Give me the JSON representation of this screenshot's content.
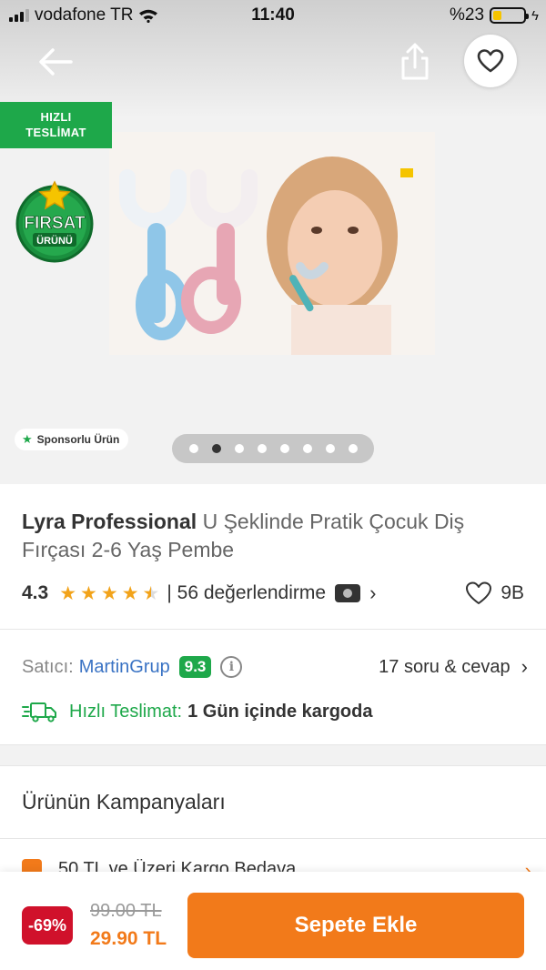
{
  "status_bar": {
    "carrier": "vodafone TR",
    "time": "11:40",
    "battery": "%23",
    "battery_level": 0.23
  },
  "header": {
    "back_icon": "arrow-left-icon",
    "share_icon": "share-icon",
    "favorite_icon": "heart-outline-icon"
  },
  "gallery": {
    "fast_badge_line1": "HIZLI",
    "fast_badge_line2": "TESLİMAT",
    "deal_badge_line1": "FIRSAT",
    "deal_badge_line2": "ÜRÜNÜ",
    "sponsored_label": "Sponsorlu Ürün",
    "slide_count": 8,
    "active_slide": 2
  },
  "product": {
    "brand": "Lyra Professional",
    "name": "U Şeklinde Pratik Çocuk Diş Fırçası 2-6 Yaş Pembe",
    "rating": "4.3",
    "rating_value": 4.3,
    "reviews": "| 56 değerlendirme",
    "likes": "9B"
  },
  "seller": {
    "label": "Satıcı:",
    "name": "MartinGrup",
    "score": "9.3",
    "qa": "17 soru & cevap"
  },
  "delivery": {
    "label": "Hızlı Teslimat:",
    "text": "1 Gün içinde kargoda"
  },
  "campaigns": {
    "title": "Ürünün Kampanyaları",
    "first_item": "50 TL ve Üzeri Kargo Bedava"
  },
  "bottom_bar": {
    "discount": "-69%",
    "old_price": "99.00 TL",
    "new_price": "29.90 TL",
    "add_to_cart": "Sepete Ekle"
  },
  "colors": {
    "brand_orange": "#f27a1a",
    "fast_green": "#1ea84a",
    "discount_red": "#d0112b",
    "star_orange": "#f2a31a",
    "seller_blue": "#3a73c4"
  }
}
